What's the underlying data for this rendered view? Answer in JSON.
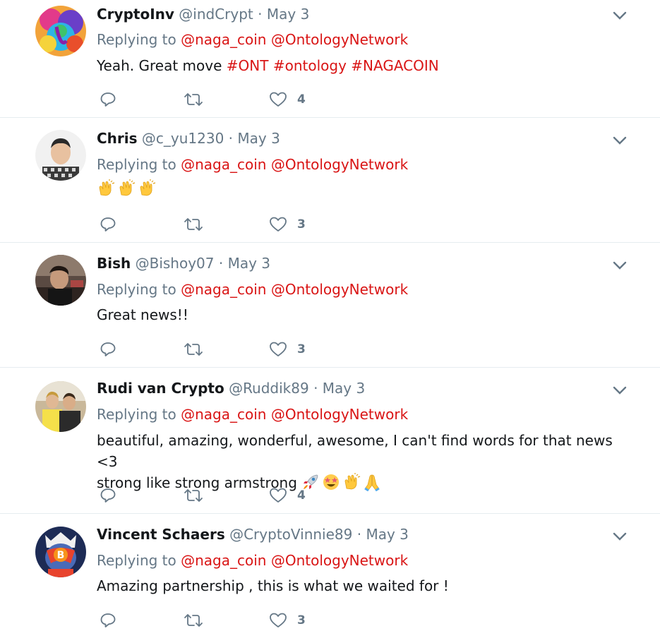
{
  "tweets": [
    {
      "name": "CryptoInv",
      "handle": "@indCrypt",
      "sep": " · ",
      "date": "May 3",
      "replying_prefix": "Replying to",
      "mentions": [
        "@naga_coin",
        "@OntologyNetwork"
      ],
      "text_plain": "Yeah. Great move",
      "hashtags": [
        "#ONT",
        "#ontology",
        "#NAGACOIN"
      ],
      "likes": "4",
      "avatar": "colorful-elephant-art"
    },
    {
      "name": "Chris",
      "handle": "@c_yu1230",
      "sep": " · ",
      "date": "May 3",
      "replying_prefix": "Replying to",
      "mentions": [
        "@naga_coin",
        "@OntologyNetwork"
      ],
      "emojis": [
        "clapping-hands",
        "clapping-hands",
        "clapping-hands"
      ],
      "likes": "3",
      "avatar": "man-checkered-shirt"
    },
    {
      "name": "Bish",
      "handle": "@Bishoy07",
      "sep": " · ",
      "date": "May 3",
      "replying_prefix": "Replying to",
      "mentions": [
        "@naga_coin",
        "@OntologyNetwork"
      ],
      "text_plain": "Great news!!",
      "likes": "3",
      "avatar": "man-dark-photo"
    },
    {
      "name": "Rudi van Crypto",
      "handle": "@Ruddik89",
      "sep": " · ",
      "date": "May 3",
      "replying_prefix": "Replying to",
      "mentions": [
        "@naga_coin",
        "@OntologyNetwork"
      ],
      "text_line1": "beautiful, amazing, wonderful, awesome, I can't find words for that news <3",
      "text_line2": "strong like strong armstrong",
      "emojis": [
        "rocket",
        "star-struck",
        "clapping-hands",
        "folded-hands"
      ],
      "likes": "4",
      "avatar": "two-men-photo"
    },
    {
      "name": "Vincent Schaers",
      "handle": "@CryptoVinnie89",
      "sep": " · ",
      "date": "May 3",
      "replying_prefix": "Replying to",
      "mentions": [
        "@naga_coin",
        "@OntologyNetwork"
      ],
      "text_plain": "Amazing partnership , this is what we waited for !",
      "likes": "3",
      "avatar": "bitcoin-superhero"
    }
  ],
  "colors": {
    "link": "#d91515",
    "secondary": "#657786",
    "text": "#14171a",
    "divider": "#e6ecf0"
  }
}
